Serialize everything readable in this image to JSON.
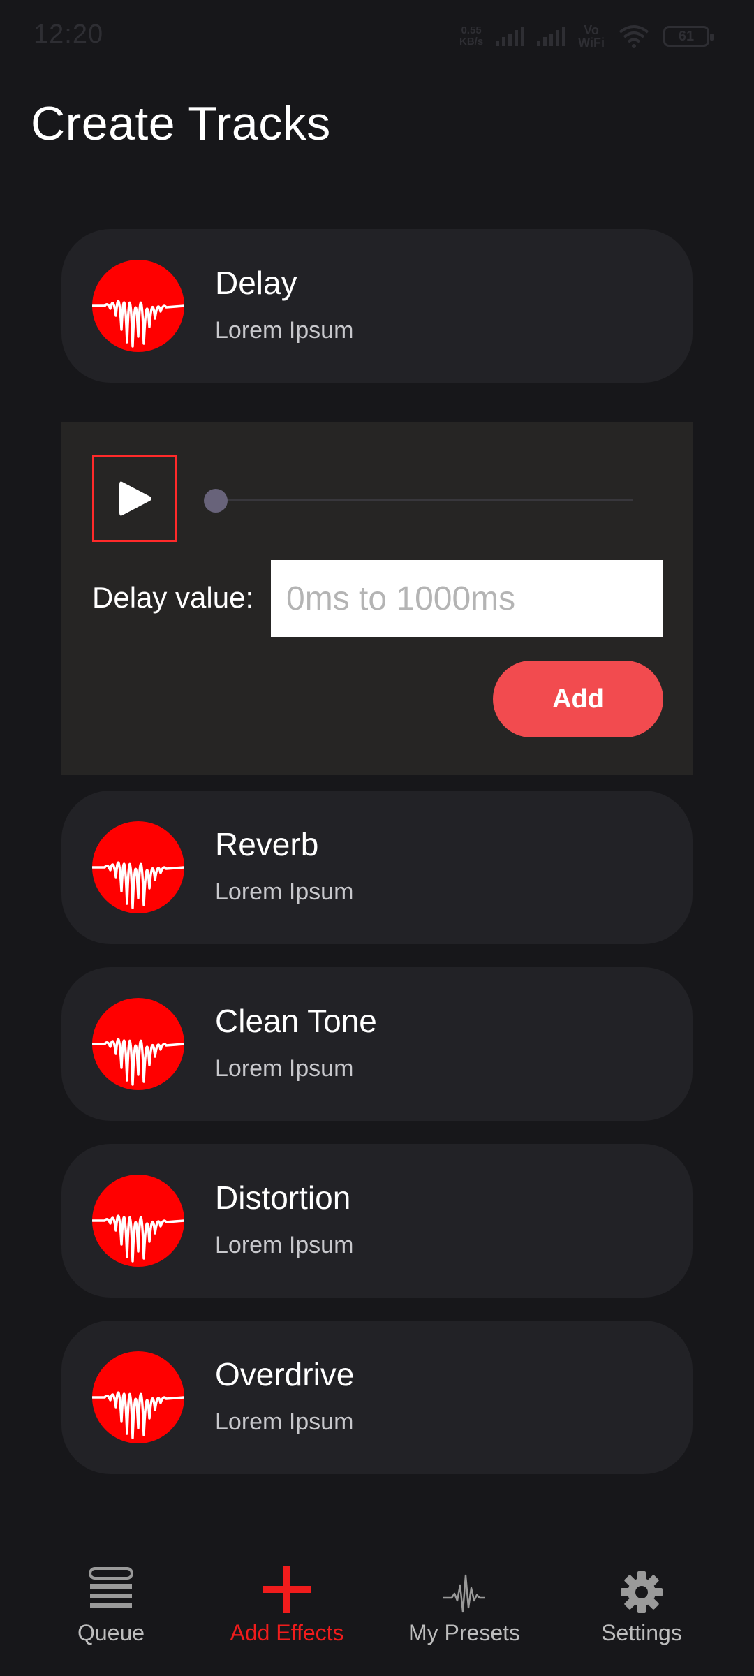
{
  "status_bar": {
    "time": "12:20",
    "net_speed_value": "0.55",
    "net_speed_unit": "KB/s",
    "vowifi_top": "Vo",
    "vowifi_bottom": "WiFi",
    "battery": "61",
    "icons": [
      "signal-icon",
      "signal-icon",
      "wifi-icon",
      "battery-icon"
    ]
  },
  "header": {
    "title": "Create Tracks"
  },
  "effects": [
    {
      "name": "Delay",
      "subtitle": "Lorem Ipsum",
      "icon": "sound-wave-icon"
    },
    {
      "name": "Reverb",
      "subtitle": "Lorem Ipsum",
      "icon": "sound-wave-icon"
    },
    {
      "name": "Clean Tone",
      "subtitle": "Lorem Ipsum",
      "icon": "sound-wave-icon"
    },
    {
      "name": "Distortion",
      "subtitle": "Lorem Ipsum",
      "icon": "sound-wave-icon"
    },
    {
      "name": "Overdrive",
      "subtitle": "Lorem Ipsum",
      "icon": "sound-wave-icon"
    }
  ],
  "delay_panel": {
    "play_icon": "play-icon",
    "slider_position": 0,
    "label": "Delay value:",
    "input_value": "",
    "input_placeholder": "0ms to 1000ms",
    "add_label": "Add"
  },
  "nav": {
    "items": [
      {
        "label": "Queue",
        "icon": "queue-icon",
        "active": false
      },
      {
        "label": "Add Effects",
        "icon": "plus-icon",
        "active": true
      },
      {
        "label": "My Presets",
        "icon": "waveform-icon",
        "active": false
      },
      {
        "label": "Settings",
        "icon": "gear-icon",
        "active": false
      }
    ]
  },
  "colors": {
    "background": "#17171a",
    "card": "#222226",
    "panel": "#262524",
    "accent_red": "#ff0000",
    "add_button": "#f24b4f",
    "nav_active": "#f01c1c",
    "nav_inactive": "#bdbdbd",
    "slider_thumb": "#68637a"
  }
}
